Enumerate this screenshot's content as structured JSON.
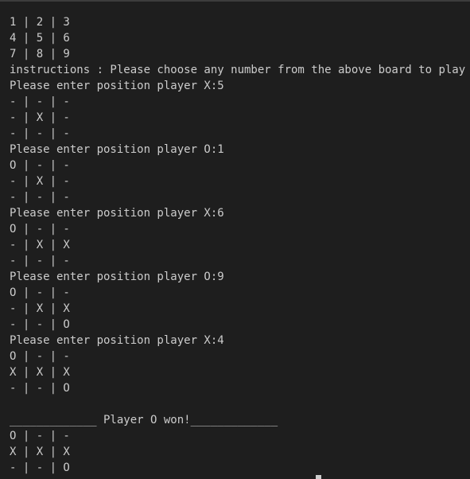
{
  "terminal": {
    "lines": [
      "1 | 2 | 3",
      "4 | 5 | 6",
      "7 | 8 | 9",
      "instructions : Please choose any number from the above board to play",
      "Please enter position player X:5",
      "- | - | -",
      "- | X | -",
      "- | - | -",
      "Please enter position player O:1",
      "O | - | -",
      "- | X | -",
      "- | - | -",
      "Please enter position player X:6",
      "O | - | -",
      "- | X | X",
      "- | - | -",
      "Please enter position player O:9",
      "O | - | -",
      "- | X | X",
      "- | - | O",
      "Please enter position player X:4",
      "O | - | -",
      "X | X | X",
      "- | - | O",
      "",
      "_____________ Player O won!_____________",
      "O | - | -",
      "X | X | X",
      "- | - | O"
    ]
  },
  "colors": {
    "background": "#1e1e1e",
    "text": "#cccccc",
    "cursor": "#cccccc"
  }
}
